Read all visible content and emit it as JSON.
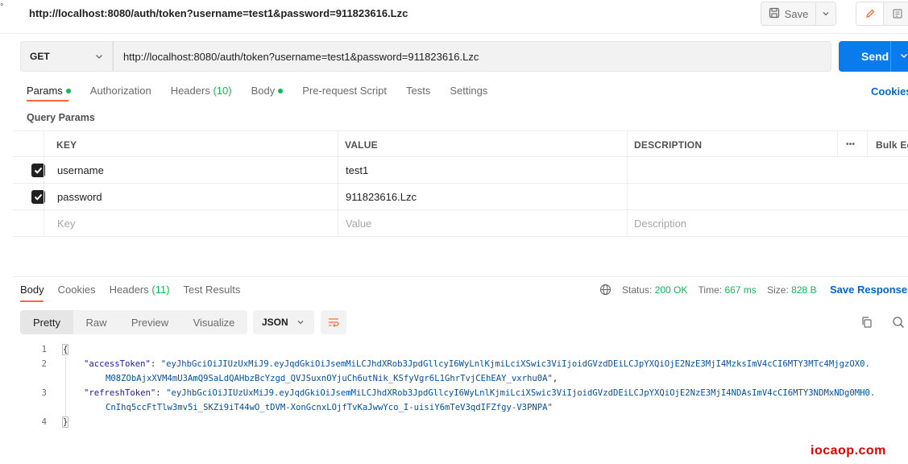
{
  "left_glyph": "°",
  "title": "http://localhost:8080/auth/token?username=test1&password=911823616.Lzc",
  "toolbar": {
    "save_label": "Save"
  },
  "request": {
    "method": "GET",
    "url": "http://localhost:8080/auth/token?username=test1&password=911823616.Lzc",
    "send_label": "Send"
  },
  "req_tabs": {
    "params": "Params",
    "authorization": "Authorization",
    "headers": "Headers",
    "headers_count": "(10)",
    "body": "Body",
    "prerequest": "Pre-request Script",
    "tests": "Tests",
    "settings": "Settings"
  },
  "cookies_label": "Cookies",
  "query_params_label": "Query Params",
  "params_table": {
    "headers": {
      "key": "KEY",
      "value": "VALUE",
      "description": "DESCRIPTION",
      "more": "•••",
      "bulk_edit": "Bulk Edit"
    },
    "rows": [
      {
        "key": "username",
        "value": "test1",
        "description": ""
      },
      {
        "key": "password",
        "value": "911823616.Lzc",
        "description": ""
      }
    ],
    "placeholders": {
      "key": "Key",
      "value": "Value",
      "description": "Description"
    }
  },
  "response": {
    "tabs": {
      "body": "Body",
      "cookies": "Cookies",
      "headers": "Headers",
      "headers_count": "(11)",
      "test_results": "Test Results"
    },
    "status_label": "Status:",
    "status_value": "200 OK",
    "time_label": "Time:",
    "time_value": "667 ms",
    "size_label": "Size:",
    "size_value": "828 B",
    "save_response": "Save Response",
    "views": {
      "pretty": "Pretty",
      "raw": "Raw",
      "preview": "Preview",
      "visualize": "Visualize"
    },
    "format": "JSON",
    "code": {
      "line_numbers": [
        "1",
        "2",
        "",
        "3",
        "",
        "4"
      ],
      "open_brace": "{",
      "close_brace": "}",
      "access_key": "\"accessToken\"",
      "access_value_1": "\"eyJhbGciOiJIUzUxMiJ9.eyJqdGkiOiJsemMiLCJhdXRob3JpdGllcyI6WyLnlKjmiLciXSwic3ViIjoidGVzdDEiLCJpYXQiOjE2NzE3MjI4MzksImV4cCI6MTY3MTc4MjgzOX0.",
      "access_value_2": "M08ZObAjxXVM4mU3AmQ9SaLdQAHbzBcYzgd_QVJSuxnOYjuCh6utNik_KSfyVgr6L1GhrTvjCEhEAY_vxrhu0A\"",
      "refresh_key": "\"refreshToken\"",
      "refresh_value_1": "\"eyJhbGciOiJIUzUxMiJ9.eyJqdGkiOiJsemMiLCJhdXRob3JpdGllcyI6WyLnlKjmiLciXSwic3ViIjoidGVzdDEiLCJpYXQiOjE2NzE3MjI4NDAsImV4cCI6MTY3NDMxNDg0MH0.",
      "refresh_value_2": "CnIhq5ccFtTlw3mv5i_SKZi9iT44wO_tDVM-XonGcnxLOjfTvKaJwwYco_I-uisiY6mTeV3qdIFZfgy-V3PNPA\""
    },
    "watermark": "iocaop.com"
  },
  "colors": {
    "accent": "#ff6c37",
    "send": "#097bed",
    "success": "#0cbb52",
    "link": "#0265d2"
  }
}
